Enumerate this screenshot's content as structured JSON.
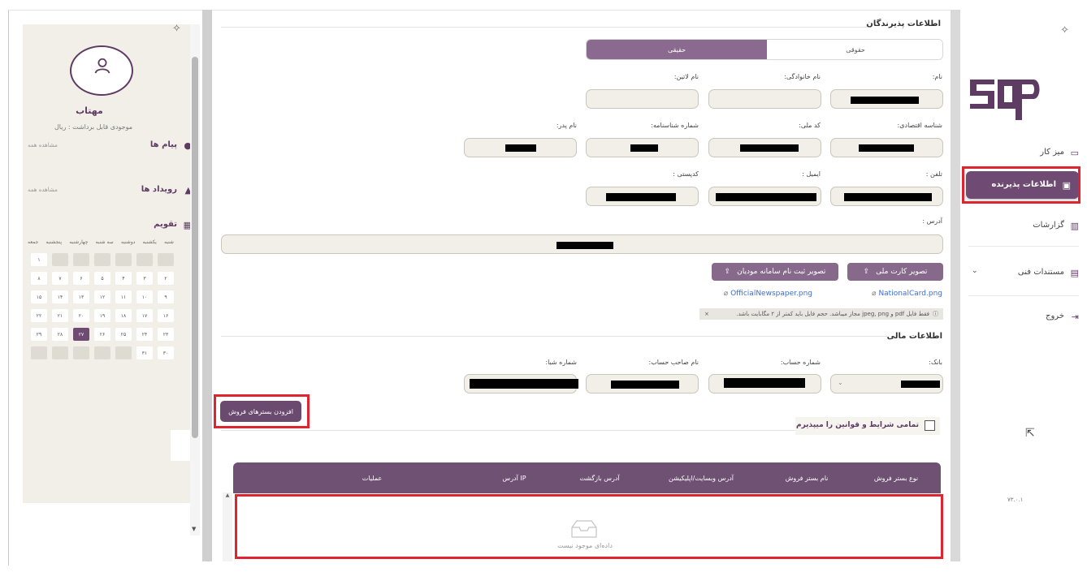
{
  "left_panel": {
    "user_name": "مهتاب",
    "balance": "موجودی قابل برداشت : ریال",
    "messages_title": "پیام ها",
    "messages_see_all": "مشاهده همه",
    "events_title": "رویداد ها",
    "events_see_all": "مشاهده همه",
    "calendar_title": "تقویم",
    "weekdays": [
      "شنبه",
      "یکشنبه",
      "دوشنبه",
      "سه شنبه",
      "چهارشنبه",
      "پنجشنبه",
      "جمعه"
    ],
    "calendar_days": [
      "",
      "",
      "",
      "",
      "",
      "",
      "۱",
      "۲",
      "۳",
      "۴",
      "۵",
      "۶",
      "۷",
      "۸",
      "۹",
      "۱۰",
      "۱۱",
      "۱۲",
      "۱۳",
      "۱۴",
      "۱۵",
      "۱۶",
      "۱۷",
      "۱۸",
      "۱۹",
      "۲۰",
      "۲۱",
      "۲۲",
      "۲۳",
      "۲۴",
      "۲۵",
      "۲۶",
      "۲۷",
      "۲۸",
      "۲۹",
      "۳۰",
      "۳۱",
      "",
      "",
      "",
      "",
      ""
    ],
    "today": "۲۷"
  },
  "sidebar": {
    "items": [
      {
        "label": "میز کار",
        "icon": "monitor-icon"
      },
      {
        "label": "اطلاعات پذیرنده",
        "icon": "user-card-icon"
      },
      {
        "label": "گزارشات",
        "icon": "chart-icon"
      },
      {
        "label": "مستندات فنی",
        "icon": "document-icon"
      },
      {
        "label": "خروج",
        "icon": "logout-icon"
      }
    ],
    "version": "۷۳.۰.۱",
    "active_color": "#6f4a73"
  },
  "form": {
    "section_title": "اطلاعات پذیرندگان",
    "type_tabs": [
      "حقیقی",
      "حقوقی"
    ],
    "labels": {
      "first_name": "نام:",
      "last_name": "نام خانوادگی:",
      "latin_name": "نام لاتین:",
      "economic_code": "شناسه اقتصادی:",
      "national_code": "کد ملی:",
      "id_number": "شماره شناسنامه:",
      "father_name": "نام پدر:",
      "phone": "تلفن :",
      "email": "ایمیل :",
      "postal_code": "کدپستی :",
      "address": "آدرس :"
    },
    "upload_national_card": "تصویر کارت ملی",
    "upload_tax_registration": "تصویر ثبت نام سامانه مودیان",
    "file_national_card": "NationalCard.png",
    "file_official_newspaper": "OfficialNewspaper.png",
    "upload_note": "فقط فایل pdf و jpeg, png مجاز میباشد. حجم فایل باید کمتر از ۲ مگابایت باشد.",
    "financial_title": "اطلاعات مالی",
    "financial_labels": {
      "bank": "بانک:",
      "account_number": "شماره حساب:",
      "account_holder": "نام صاحب حساب:",
      "sheba": "شماره شبا:"
    },
    "add_platform_button": "افزودن بسترهای فروش",
    "terms_label": "تمامی شرایط و قوانین را میپذیرم"
  },
  "table": {
    "columns": [
      "نوع بستر فروش",
      "نام بستر فروش",
      "آدرس وبسایت/اپلیکیشن",
      "آدرس بازگشت",
      "آدرس IP",
      "عملیات"
    ],
    "empty_text": "داده‌ای موجود نیست"
  },
  "colors": {
    "brand": "#5e3b63",
    "highlight": "#e0242f",
    "link": "#3b6dd8"
  }
}
